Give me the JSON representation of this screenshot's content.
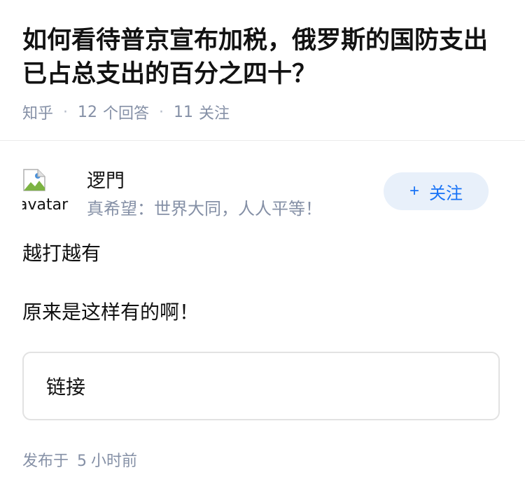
{
  "question": {
    "title": "如何看待普京宣布加税，俄罗斯的国防支出已占总支出的百分之四十？",
    "source": "知乎",
    "separator": "·",
    "answer_count": "12",
    "answer_label": "个回答",
    "follower_count": "11",
    "follower_label": "关注"
  },
  "author": {
    "avatar_alt": "avatar",
    "name": "逻門",
    "bio": "真希望：世界大同，人人平等！",
    "follow_plus": "+",
    "follow_label": "关注"
  },
  "answer": {
    "paragraphs": [
      "越打越有",
      "原来是这样有的啊！"
    ],
    "link_card_label": "链接"
  },
  "footer": {
    "publish_prefix": "发布于",
    "publish_num": "5",
    "publish_suffix": "小时前"
  },
  "colors": {
    "accent": "#1772f6",
    "muted": "#8590a6",
    "follow_bg": "#e8f0fa"
  }
}
